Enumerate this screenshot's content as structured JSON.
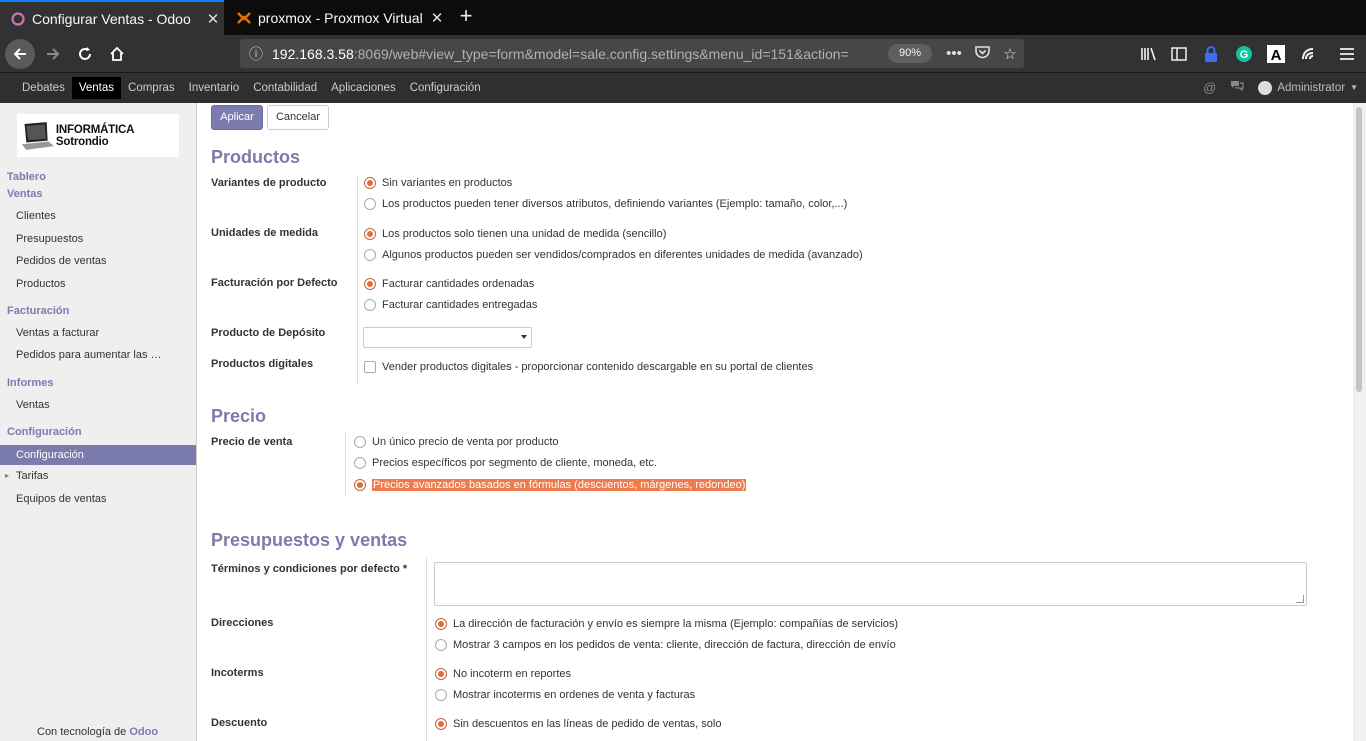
{
  "browser": {
    "tabs": [
      {
        "title": "Configurar Ventas - Odoo",
        "close": "✕"
      },
      {
        "title": "proxmox - Proxmox Virtual Environment",
        "close": "✕"
      }
    ],
    "new_tab": "+",
    "url_host": "192.168.3.58",
    "url_rest": ":8069/web#view_type=form&model=sale.config.settings&menu_id=151&action=",
    "zoom": "90%",
    "more": "•••"
  },
  "odoo_menu": {
    "items": [
      "Debates",
      "Ventas",
      "Compras",
      "Inventario",
      "Contabilidad",
      "Aplicaciones",
      "Configuración"
    ],
    "active": "Ventas",
    "user": "Administrator"
  },
  "sidebar": {
    "logo_text": "INFORMÁTICA Sotrondio",
    "tablero": "Tablero",
    "ventas_header": "Ventas",
    "ventas_items": [
      "Clientes",
      "Presupuestos",
      "Pedidos de ventas",
      "Productos"
    ],
    "facturacion_header": "Facturación",
    "facturacion_items": [
      "Ventas a facturar",
      "Pedidos para aumentar las …"
    ],
    "informes_header": "Informes",
    "informes_items": [
      "Ventas"
    ],
    "config_header": "Configuración",
    "config_selected": "Configuración",
    "config_items": [
      "Tarifas",
      "Equipos de ventas"
    ],
    "tarifas_arrow": "▸",
    "powered_prefix": "Con tecnología de ",
    "powered_brand": "Odoo"
  },
  "buttons": {
    "apply": "Aplicar",
    "cancel": "Cancelar"
  },
  "sections": {
    "productos": {
      "title": "Productos",
      "variantes": {
        "label": "Variantes de producto",
        "options": [
          "Sin variantes en productos",
          "Los productos pueden tener diversos atributos, definiendo variantes (Ejemplo: tamaño, color,...)"
        ],
        "selected": 0
      },
      "unidades": {
        "label": "Unidades de medida",
        "options": [
          "Los productos solo tienen una unidad de medida (sencillo)",
          "Algunos productos pueden ser vendidos/comprados en diferentes unidades de medida (avanzado)"
        ],
        "selected": 0
      },
      "facturacion": {
        "label": "Facturación por Defecto",
        "options": [
          "Facturar cantidades ordenadas",
          "Facturar cantidades entregadas"
        ],
        "selected": 0
      },
      "deposito": {
        "label": "Producto de Depósito",
        "value": ""
      },
      "digitales": {
        "label": "Productos digitales",
        "option": "Vender productos digitales - proporcionar contenido descargable en su portal de clientes",
        "checked": false
      }
    },
    "precio": {
      "title": "Precio",
      "precio_venta": {
        "label": "Precio de venta",
        "options": [
          "Un único precio de venta por producto",
          "Precios específicos por segmento de cliente, moneda, etc.",
          "Precios avanzados basados en fórmulas (descuentos, márgenes, redondeo)"
        ],
        "selected": 2
      }
    },
    "presupuestos": {
      "title": "Presupuestos y ventas",
      "terminos": {
        "label": "Términos y condiciones por defecto *",
        "value": ""
      },
      "direcciones": {
        "label": "Direcciones",
        "options": [
          "La dirección de facturación y envío es siempre la misma (Ejemplo: compañías de servicios)",
          "Mostrar 3 campos en los pedidos de venta: cliente, dirección de factura, dirección de envío"
        ],
        "selected": 0
      },
      "incoterms": {
        "label": "Incoterms",
        "options": [
          "No incoterm en reportes",
          "Mostrar incoterms en ordenes de venta y facturas"
        ],
        "selected": 0
      },
      "descuento": {
        "label": "Descuento",
        "options": [
          "Sin descuentos en las líneas de pedido de ventas, solo"
        ],
        "selected": 0
      }
    }
  },
  "colors": {
    "odoo_accent": "#7c7bad",
    "radio_on": "#e06c3a",
    "highlight": "#ee7a4d"
  }
}
